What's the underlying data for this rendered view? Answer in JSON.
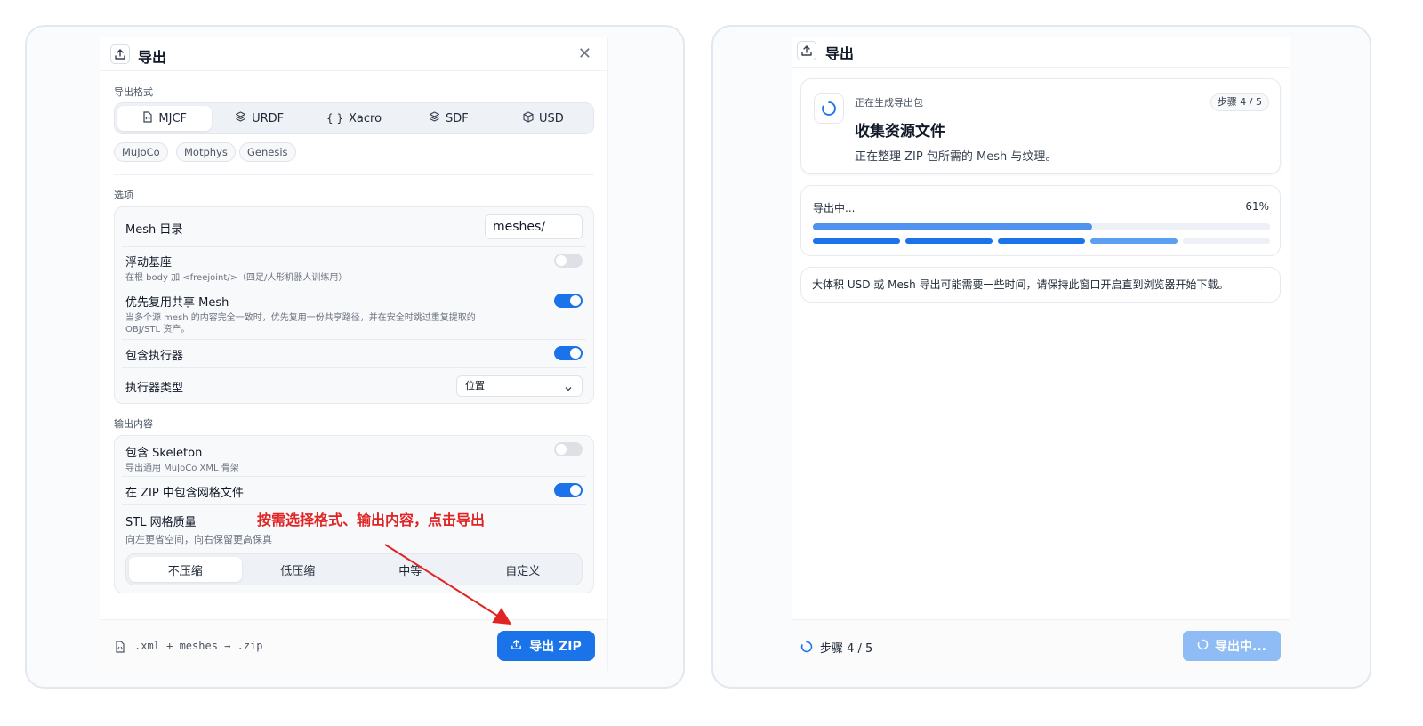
{
  "left": {
    "title": "导出",
    "format_label": "导出格式",
    "formats": [
      {
        "label": "MJCF",
        "icon": "file-code-icon",
        "active": true
      },
      {
        "label": "URDF",
        "icon": "layers-icon",
        "active": false
      },
      {
        "label": "Xacro",
        "icon": "braces-icon",
        "active": false
      },
      {
        "label": "SDF",
        "icon": "layers-icon",
        "active": false
      },
      {
        "label": "USD",
        "icon": "cube-icon",
        "active": false
      }
    ],
    "targets": [
      "MuJoCo",
      "Motphys",
      "Genesis"
    ],
    "options_label": "选项",
    "options": {
      "mesh_dir_label": "Mesh 目录",
      "mesh_dir_value": "meshes/",
      "floating_base": {
        "title": "浮动基座",
        "sub": "在根 body 加 <freejoint/>（四足/人形机器人训练用）",
        "on": false
      },
      "reuse_mesh": {
        "title": "优先复用共享 Mesh",
        "sub": "当多个源 mesh 的内容完全一致时，优先复用一份共享路径，并在安全时跳过重复提取的 OBJ/STL 资产。",
        "on": true
      },
      "actuators": {
        "title": "包含执行器",
        "on": true
      },
      "actuator_type": {
        "title": "执行器类型",
        "value": "位置"
      }
    },
    "output_label": "输出内容",
    "output": {
      "skeleton": {
        "title": "包含 Skeleton",
        "sub": "导出通用 MuJoCo XML 骨架",
        "on": false
      },
      "zip_mesh": {
        "title": "在 ZIP 中包含网格文件",
        "on": true
      },
      "stl_quality": {
        "title": "STL 网格质量",
        "sub": "向左更省空间，向右保留更高保真"
      },
      "quality_options": [
        "不压缩",
        "低压缩",
        "中等",
        "自定义"
      ]
    },
    "annotation": "按需选择格式、输出内容，点击导出",
    "footer_code": ".xml + meshes → .zip",
    "export_button": "导出 ZIP"
  },
  "right": {
    "title": "导出",
    "status_small": "正在生成导出包",
    "status_title": "收集资源文件",
    "status_desc": "正在整理 ZIP 包所需的 Mesh 与纹理。",
    "step_badge": "步骤 4 / 5",
    "progress_label": "导出中...",
    "progress_percent_text": "61%",
    "progress_fraction": 0.61,
    "steps_done": 3,
    "steps_current": 4,
    "steps_total": 5,
    "note": "大体积 USD 或 Mesh 导出可能需要一些时间，请保持此窗口开启直到浏览器开始下载。",
    "footer_step": "步骤 4 / 5",
    "exporting_button": "导出中..."
  },
  "colors": {
    "accent": "#1a73e8",
    "annotation": "#e02424",
    "disabled": "#8fbcf5",
    "step_pending": "#5ba0f0"
  }
}
